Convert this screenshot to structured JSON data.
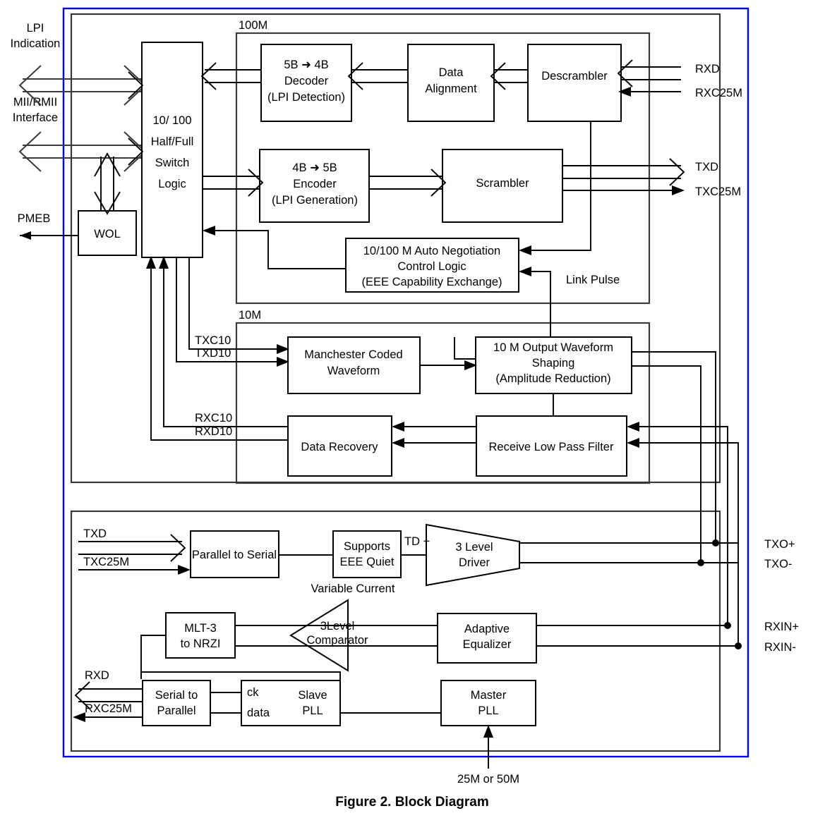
{
  "figure": {
    "caption": "Figure 2.   Block Diagram",
    "frame_color": "#0000ff"
  },
  "section_labels": {
    "hundred_m": "100M",
    "ten_m": "10M"
  },
  "left_ports": [
    {
      "id": "lpi",
      "label_line1": "LPI",
      "label_line2": "Indication"
    },
    {
      "id": "mii",
      "label_line1": "MII/RMII",
      "label_line2": "Interface"
    },
    {
      "id": "pmeb",
      "label_line1": "PMEB",
      "label_line2": ""
    }
  ],
  "blocks": {
    "switch_logic": {
      "line1": "10/ 100",
      "line2": "Half/Full",
      "line3": "Switch",
      "line4": "Logic"
    },
    "wol": {
      "line1": "WOL"
    },
    "decoder_5b4b": {
      "line1": "5B ➜  4B",
      "line2": "Decoder",
      "line3": "(LPI Detection)"
    },
    "data_alignment": {
      "line1": "Data",
      "line2": "Alignment"
    },
    "descrambler": {
      "line1": "Descrambler"
    },
    "encoder_4b5b": {
      "line1": "4B ➜  5B",
      "line2": "Encoder",
      "line3": "(LPI Generation)"
    },
    "scrambler": {
      "line1": "Scrambler"
    },
    "auto_negotiation": {
      "line1": "10/100 M Auto Negotiation",
      "line2": "Control Logic",
      "line3": "(EEE Capability Exchange)"
    },
    "manchester": {
      "line1": "Manchester Coded",
      "line2": "Waveform"
    },
    "output_waveform": {
      "line1": "10 M Output Waveform",
      "line2": "Shaping",
      "line3": "(Amplitude Reduction)"
    },
    "data_recovery": {
      "line1": "Data Recovery"
    },
    "receive_lpf": {
      "line1": "Receive Low Pass Filter"
    },
    "parallel_to_serial": {
      "line1": "Parallel to Serial"
    },
    "supports_eee_quiet": {
      "line1": "Supports",
      "line2": "EEE Quiet"
    },
    "three_level_driver": {
      "line1": "3 Level",
      "line2": "Driver"
    },
    "mlt3_to_nrzi": {
      "line1": "MLT-3",
      "line2": "to NRZI"
    },
    "three_level_comparator": {
      "line1": "3Level",
      "line2": "Comparator"
    },
    "adaptive_equalizer": {
      "line1": "Adaptive",
      "line2": "Equalizer"
    },
    "serial_to_parallel": {
      "line1": "Serial to",
      "line2": "Parallel"
    },
    "slave_pll": {
      "line1": "Slave",
      "line2": "PLL",
      "pin_ck": "ck",
      "pin_data": "data"
    },
    "master_pll": {
      "line1": "Master",
      "line2": "PLL"
    }
  },
  "signals": {
    "rxd_top": "RXD",
    "rxc25m_top": "RXC25M",
    "txd_top": "TXD",
    "txc25m_top": "TXC25M",
    "link_pulse": "Link Pulse",
    "txc10": "TXC10",
    "txd10": "TXD10",
    "rxc10": "RXC10",
    "rxd10": "RXD10",
    "txd_bot": "TXD",
    "txc25m_bot": "TXC25M",
    "rxd_bot": "RXD",
    "rxc25m_bot": "RXC25M",
    "td_plus": "TD +",
    "variable_current": "Variable  Current",
    "txo_plus": "TXO+",
    "txo_minus": "TXO-",
    "rxin_plus": "RXIN+",
    "rxin_minus": "RXIN-",
    "clock_source": "25M or 50M"
  }
}
